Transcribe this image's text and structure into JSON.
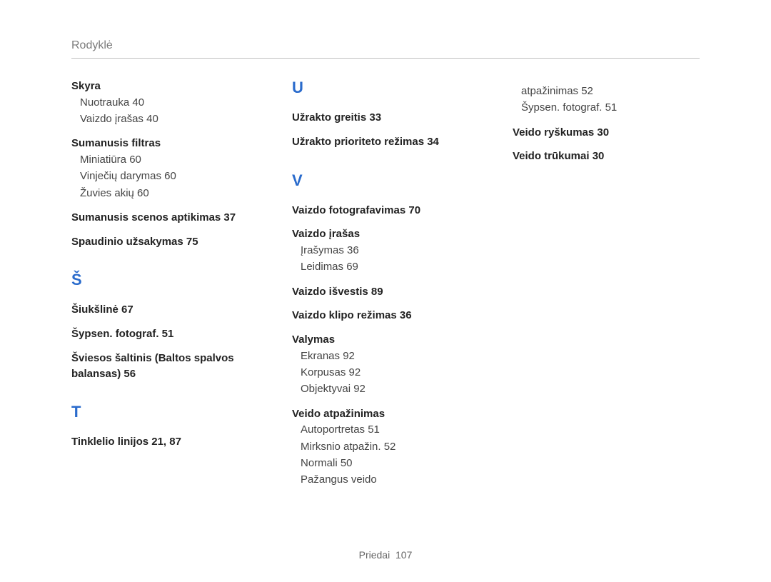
{
  "header": "Rodyklė",
  "footer_label": "Priedai",
  "footer_page": "107",
  "col1": {
    "skyra_head": "Skyra",
    "skyra_sub1": "Nuotrauka  40",
    "skyra_sub2": "Vaizdo įrašas  40",
    "sumanusis_filtras_head": "Sumanusis filtras",
    "sumanusis_filtras_sub1": "Miniatiūra  60",
    "sumanusis_filtras_sub2": "Vinječių darymas  60",
    "sumanusis_filtras_sub3": "Žuvies akių  60",
    "sumanusis_scenos_head": "Sumanusis scenos aptikimas  37",
    "spaudinio_head": "Spaudinio užsakymas  75",
    "letter_S": "Š",
    "siuksline_head": "Šiukšlinė  67",
    "sypsen_head": "Šypsen. fotograf.  51",
    "sviesos_head": "Šviesos šaltinis (Baltos spalvos balansas)  56",
    "letter_T": "T",
    "tinklelio_head": "Tinklelio linijos  21, 87"
  },
  "col2": {
    "letter_U": "U",
    "uzrakto_greitis_head": "Užrakto greitis  33",
    "uzrakto_prioriteto_head": "Užrakto prioriteto režimas  34",
    "letter_V": "V",
    "vaizdo_foto_head": "Vaizdo fotografavimas  70",
    "vaizdo_irasas_head": "Vaizdo įrašas",
    "vaizdo_irasas_sub1": "Įrašymas  36",
    "vaizdo_irasas_sub2": "Leidimas  69",
    "vaizdo_isvestis_head": "Vaizdo išvestis  89",
    "vaizdo_klipo_head": "Vaizdo klipo režimas  36",
    "valymas_head": "Valymas",
    "valymas_sub1": "Ekranas  92",
    "valymas_sub2": "Korpusas  92",
    "valymas_sub3": "Objektyvai  92",
    "veido_atp_head": "Veido atpažinimas",
    "veido_atp_sub1": "Autoportretas  51",
    "veido_atp_sub2": "Mirksnio atpažin.  52",
    "veido_atp_sub3": "Normali  50",
    "veido_atp_sub4": "Pažangus veido"
  },
  "col3": {
    "atpazinimas_sub": "atpažinimas  52",
    "sypsen_sub": "Šypsen. fotograf.  51",
    "veido_rysk_head": "Veido ryškumas  30",
    "veido_truk_head": "Veido trūkumai  30"
  }
}
